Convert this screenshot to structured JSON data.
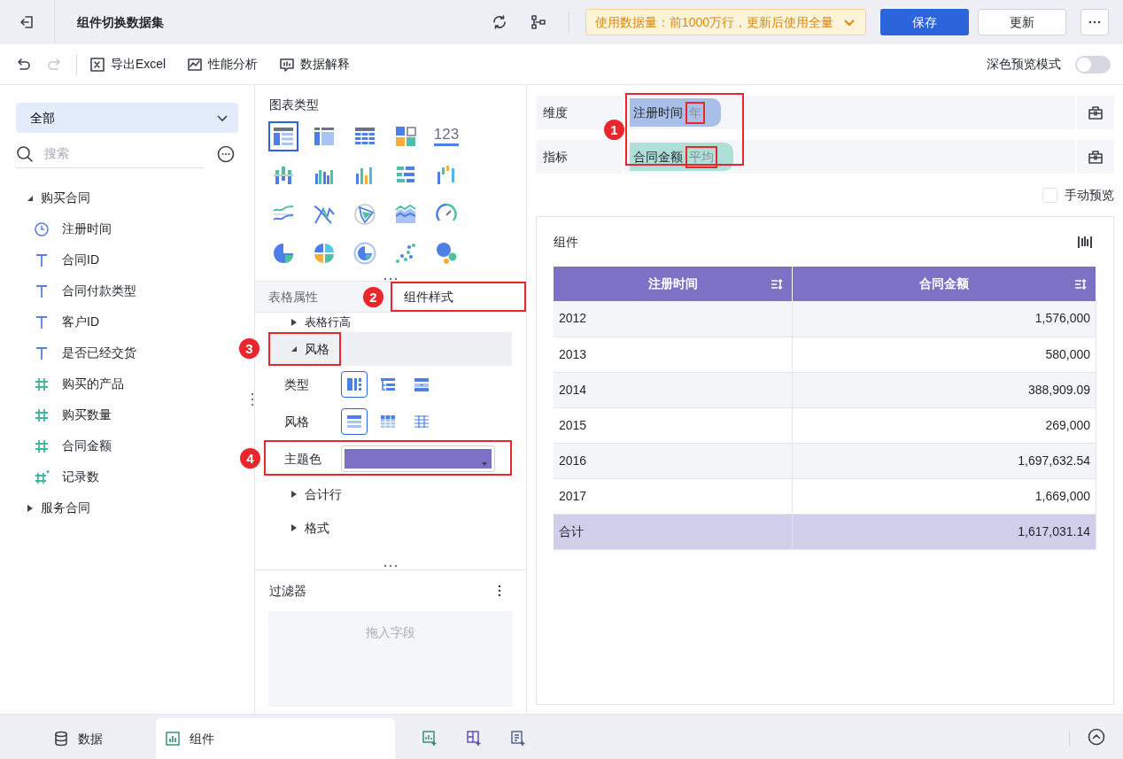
{
  "header": {
    "title": "组件切换数据集",
    "notice": "使用数据量：前1000万行，更新后使用全量",
    "buttons": [
      {
        "label": "保存",
        "kind": "primary"
      },
      {
        "label": "更新",
        "kind": "secondary"
      }
    ]
  },
  "toolbar": {
    "redo_disabled": true,
    "items": [
      {
        "label": "导出Excel",
        "kind": "excel"
      },
      {
        "label": "性能分析",
        "kind": "analysis"
      },
      {
        "label": "数据解释",
        "kind": "explain"
      }
    ],
    "dark_preview": {
      "label": "深色预览模式",
      "on": false
    }
  },
  "data_panel": {
    "scope": "全部",
    "search": {
      "placeholder": "搜索"
    },
    "tree": [
      {
        "label": "购买合同",
        "expanded": true,
        "children": [
          {
            "label": "注册时间",
            "kind": "date"
          },
          {
            "label": "合同ID",
            "kind": "text"
          },
          {
            "label": "合同付款类型",
            "kind": "text"
          },
          {
            "label": "客户ID",
            "kind": "text"
          },
          {
            "label": "是否已经交货",
            "kind": "text"
          },
          {
            "label": "购买的产品",
            "kind": "number"
          },
          {
            "label": "购买数量",
            "kind": "number"
          },
          {
            "label": "合同金额",
            "kind": "number"
          },
          {
            "label": "记录数",
            "kind": "count"
          }
        ]
      },
      {
        "label": "服务合同",
        "expanded": false
      }
    ]
  },
  "chart_types": {
    "title": "图表类型",
    "items": [
      {
        "kind": "detail-table",
        "selected": true
      },
      {
        "kind": "group-table",
        "selected": false
      },
      {
        "kind": "cross-table",
        "selected": false
      },
      {
        "kind": "card",
        "selected": false
      },
      {
        "kind": "kpi",
        "label": "123",
        "selected": false
      },
      {
        "kind": "bar-split",
        "selected": false
      },
      {
        "kind": "bar",
        "selected": false
      },
      {
        "kind": "bar-multi",
        "selected": false
      },
      {
        "kind": "bar-horizontal",
        "selected": false
      },
      {
        "kind": "waterfall",
        "selected": false
      },
      {
        "kind": "line",
        "selected": false
      },
      {
        "kind": "line-cross",
        "selected": false
      },
      {
        "kind": "radar",
        "selected": false
      },
      {
        "kind": "area",
        "selected": false
      },
      {
        "kind": "gauge",
        "selected": false
      },
      {
        "kind": "pie",
        "selected": false
      },
      {
        "kind": "pie-quad",
        "selected": false
      },
      {
        "kind": "pie-ring",
        "selected": false
      },
      {
        "kind": "scatter",
        "selected": false
      },
      {
        "kind": "bubble",
        "selected": false
      }
    ]
  },
  "props": {
    "tabs": [
      {
        "label": "表格属性",
        "selected": false
      },
      {
        "label": "组件样式",
        "selected": true,
        "callout": "2"
      }
    ],
    "sections": [
      {
        "label": "表格行高",
        "expanded": false
      },
      {
        "label": "风格",
        "expanded": true,
        "callout": "3",
        "settings": [
          {
            "label": "类型",
            "kind": "options",
            "options": [
              {
                "kind": "layout-group",
                "selected": true
              },
              {
                "kind": "layout-tree",
                "selected": false
              },
              {
                "kind": "layout-fold",
                "selected": false
              }
            ]
          },
          {
            "label": "风格",
            "kind": "options",
            "options": [
              {
                "kind": "style-stripe",
                "selected": true
              },
              {
                "kind": "style-grid",
                "selected": false
              },
              {
                "kind": "style-lines",
                "selected": false
              }
            ]
          },
          {
            "label": "主题色",
            "kind": "color",
            "color": "#7b72c6",
            "callout": "4"
          }
        ]
      },
      {
        "label": "合计行",
        "expanded": false
      },
      {
        "label": "格式",
        "expanded": false
      }
    ]
  },
  "filter": {
    "title": "过滤器",
    "drop_hint": "拖入字段"
  },
  "fields": {
    "callout": "1",
    "rows": [
      {
        "label": "维度",
        "field": "注册时间",
        "aggregation": "年",
        "kind": "dimension",
        "highlighted": true
      },
      {
        "label": "指标",
        "field": "合同金额",
        "aggregation": "平均",
        "kind": "measure",
        "highlighted": true
      }
    ]
  },
  "manual_preview": {
    "label": "手动预览",
    "checked": false
  },
  "widget": {
    "title": "组件",
    "table": {
      "columns": [
        "注册时间",
        "合同金额"
      ],
      "rows": [
        [
          "2012",
          "1,576,000"
        ],
        [
          "2013",
          "580,000"
        ],
        [
          "2014",
          "388,909.09"
        ],
        [
          "2015",
          "269,000"
        ],
        [
          "2016",
          "1,697,632.54"
        ],
        [
          "2017",
          "1,669,000"
        ]
      ],
      "total": [
        "合计",
        "1,617,031.14"
      ]
    }
  },
  "bottom_tabs": [
    {
      "label": "数据",
      "kind": "data",
      "selected": false
    },
    {
      "label": "组件",
      "kind": "widget",
      "selected": true
    }
  ]
}
